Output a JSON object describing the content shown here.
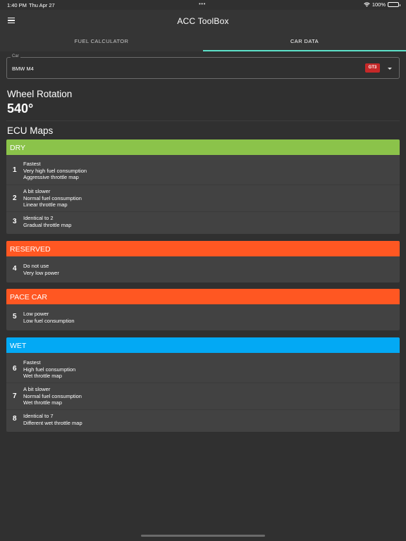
{
  "status_bar": {
    "time": "1:40 PM",
    "date": "Thu Apr 27",
    "battery": "100%"
  },
  "app_bar": {
    "title": "ACC ToolBox"
  },
  "tabs": [
    {
      "label": "FUEL CALCULATOR"
    },
    {
      "label": "CAR DATA"
    }
  ],
  "car_select": {
    "label": "Car",
    "value": "BMW M4",
    "class_badge": "GT3",
    "badge_color": "#c62828"
  },
  "wheel_rotation": {
    "title": "Wheel Rotation",
    "value": "540°"
  },
  "ecu_maps": {
    "title": "ECU Maps",
    "groups": [
      {
        "name": "DRY",
        "color": "#8bc34a",
        "rows": [
          {
            "num": "1",
            "lines": [
              "Fastest",
              "Very high fuel consumption",
              "Aggressive throttle map"
            ]
          },
          {
            "num": "2",
            "lines": [
              "A bit slower",
              "Normal fuel consumption",
              "Linear throttle map"
            ]
          },
          {
            "num": "3",
            "lines": [
              "Identical to 2",
              "Gradual throttle map"
            ]
          }
        ]
      },
      {
        "name": "RESERVED",
        "color": "#ff5722",
        "rows": [
          {
            "num": "4",
            "lines": [
              "Do not use",
              "Very low power"
            ]
          }
        ]
      },
      {
        "name": "PACE CAR",
        "color": "#ff5722",
        "rows": [
          {
            "num": "5",
            "lines": [
              "Low power",
              "Low fuel consumption"
            ]
          }
        ]
      },
      {
        "name": "WET",
        "color": "#03a9f4",
        "rows": [
          {
            "num": "6",
            "lines": [
              "Fastest",
              "High fuel consumption",
              "Wet throttle map"
            ]
          },
          {
            "num": "7",
            "lines": [
              "A bit slower",
              "Normal fuel consumption",
              "Wet throttle map"
            ]
          },
          {
            "num": "8",
            "lines": [
              "Identical to 7",
              "Different wet throttle map"
            ]
          }
        ]
      }
    ]
  },
  "colors": {
    "accent": "#5de0c9",
    "background": "#303030",
    "card": "#424242"
  }
}
